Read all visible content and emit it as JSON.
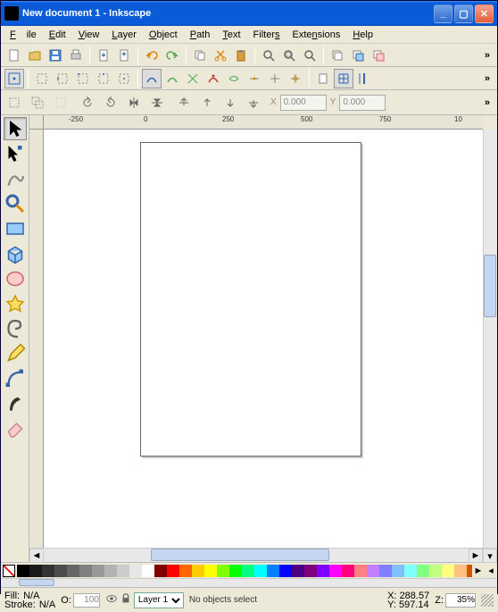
{
  "window": {
    "title": "New document 1 - Inkscape"
  },
  "menu": {
    "file": "File",
    "edit": "Edit",
    "view": "View",
    "layer": "Layer",
    "object": "Object",
    "path": "Path",
    "text": "Text",
    "filters": "Filters",
    "extensions": "Extensions",
    "help": "Help"
  },
  "coords": {
    "x_label": "X",
    "x_value": "0.000",
    "y_label": "Y",
    "y_value": "0.000"
  },
  "ruler": {
    "ticks": [
      "-250",
      "0",
      "250",
      "500",
      "750",
      "10"
    ]
  },
  "palette": [
    "#000000",
    "#1a1a1a",
    "#333333",
    "#4d4d4d",
    "#666666",
    "#808080",
    "#999999",
    "#b3b3b3",
    "#cccccc",
    "#e6e6e6",
    "#ffffff",
    "#800000",
    "#ff0000",
    "#ff6600",
    "#ffcc00",
    "#ffff00",
    "#80ff00",
    "#00ff00",
    "#00ff80",
    "#00ffff",
    "#0080ff",
    "#0000ff",
    "#4b0082",
    "#800080",
    "#8000ff",
    "#ff00ff",
    "#ff0080",
    "#ff8080",
    "#c080ff",
    "#8080ff",
    "#80c0ff",
    "#80ffff",
    "#80ff80",
    "#c0ff80",
    "#ffff80",
    "#ffc080",
    "#d45500",
    "#aa0000"
  ],
  "status": {
    "fill_label": "Fill:",
    "fill_value": "N/A",
    "stroke_label": "Stroke:",
    "stroke_value": "N/A",
    "opacity_label": "O:",
    "opacity_value": "100",
    "layer_name": "Layer 1",
    "message": "No objects select",
    "x_label": "X:",
    "x_value": "288.57",
    "y_label": "Y:",
    "y_value": "597.14",
    "zoom_label": "Z:",
    "zoom_value": "35%"
  }
}
